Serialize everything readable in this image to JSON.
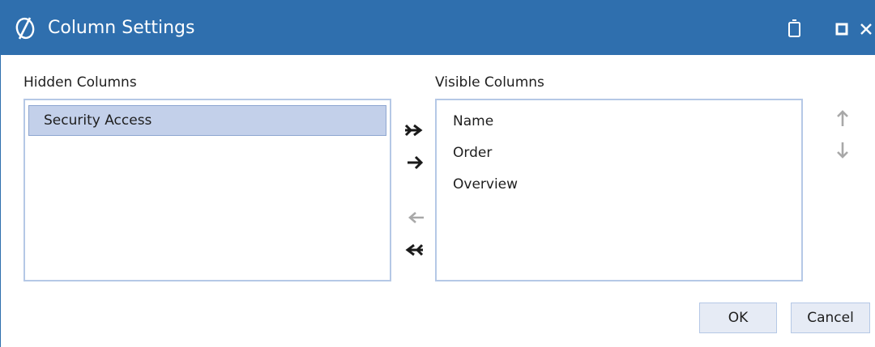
{
  "window": {
    "title": "Column Settings",
    "title_bar_color": "#2f6fae",
    "app_icon": "logo-icon",
    "controls": [
      "restore-icon",
      "maximize-icon",
      "close-icon"
    ]
  },
  "hidden_columns": {
    "label": "Hidden Columns",
    "items": [
      {
        "label": "Security Access",
        "selected": true
      }
    ]
  },
  "visible_columns": {
    "label": "Visible Columns",
    "items": [
      {
        "label": "Name"
      },
      {
        "label": "Order"
      },
      {
        "label": "Overview"
      }
    ]
  },
  "transfer_buttons": [
    "move-all-right-icon",
    "move-right-icon",
    "move-left-icon",
    "move-all-left-icon"
  ],
  "order_buttons": [
    "move-up-icon",
    "move-down-icon"
  ],
  "footer": {
    "ok_label": "OK",
    "cancel_label": "Cancel"
  },
  "colors": {
    "selection": "#c3d0ea",
    "list_border": "#b5c8e6",
    "disabled_icon": "#a8a8a8"
  }
}
